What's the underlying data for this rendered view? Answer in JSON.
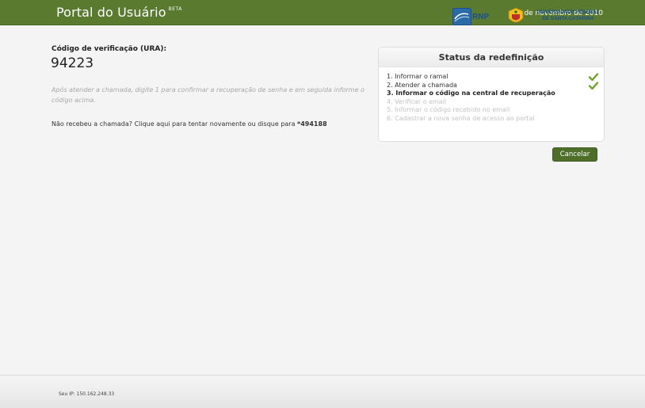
{
  "header": {
    "title": "Portal do Usuário",
    "beta": "BETA",
    "date": "24 de novembro de 2010"
  },
  "verification": {
    "label": "Código de verificação (URA):",
    "code": "94223",
    "instructions": "Após atender a chamada, digite 1 para confirmar a recuperação de senha e em seguida informe o código acima.",
    "redial_text": "Não recebeu a chamada? Clique aqui para tentar novamente ou disque para ",
    "phone": "*494188"
  },
  "status": {
    "title": "Status da redefinição",
    "steps": [
      {
        "label": "1. Informar o ramal",
        "state": "done"
      },
      {
        "label": "2. Atender a chamada",
        "state": "done"
      },
      {
        "label": "3. Informar o código na central de recuperação",
        "state": "current"
      },
      {
        "label": "4. Verificar o email",
        "state": "pending"
      },
      {
        "label": "5. Informar o código recebido no email",
        "state": "pending"
      },
      {
        "label": "6. Cadastrar a nova senha de acesso ao portal",
        "state": "pending"
      }
    ]
  },
  "actions": {
    "cancel_label": "Cancelar"
  },
  "footer": {
    "ip": "Seu IP: 150.162.248.33",
    "rnp_logo_text": "RNP",
    "ufsc_text_line1": "UNIVERSIDADE FEDERAL",
    "ufsc_text_line2": "DE SANTA CATARINA"
  },
  "colors": {
    "header_green": "#5a7a2f",
    "button_green": "#4d6f2a",
    "check_green": "#6aa52a",
    "logo_blue": "#1b4f8f"
  },
  "icons": {
    "check": "check-icon"
  }
}
